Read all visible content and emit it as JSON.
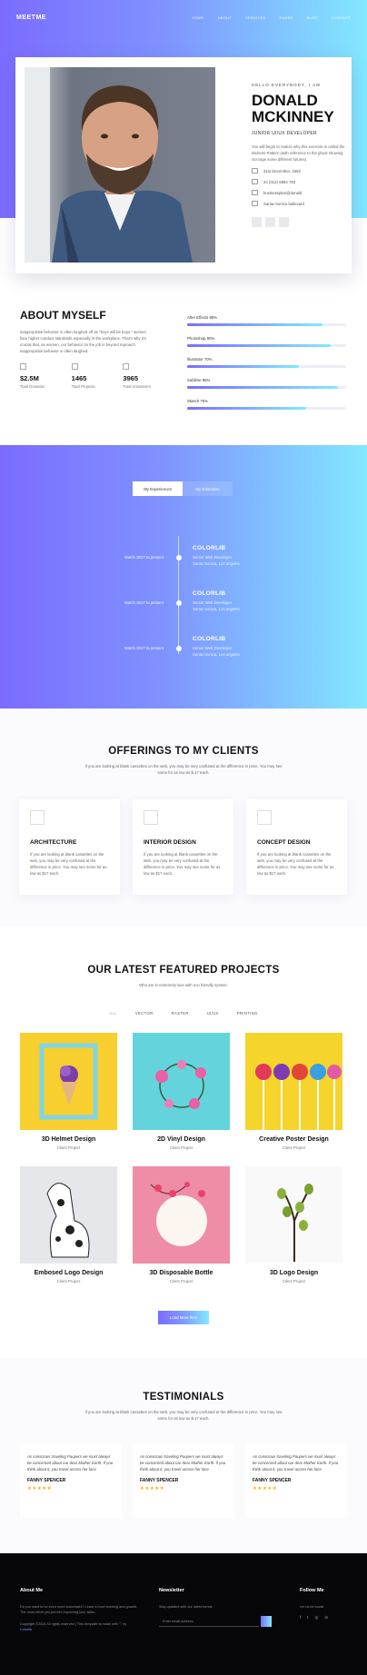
{
  "header": {
    "logo": "MEETME",
    "menu": [
      "HOME",
      "ABOUT",
      "SERVICES",
      "PAGES",
      "BLOG",
      "CONTACT"
    ]
  },
  "profile": {
    "greeting": "HELLO EVERYBODY, I AM",
    "name_line1": "DONALD",
    "name_line2": "MCKINNEY",
    "role": "JUNIOR UI/UX DEVELOPER",
    "bio": "You will begin to realize why this exercise is called the Dickens Pattern (with reference to the ghost showing Scrooge some different futures)",
    "contacts": [
      {
        "icon": "calendar-icon",
        "text": "31st December, 1992"
      },
      {
        "icon": "phone-icon",
        "text": "44 (012) 6954 783"
      },
      {
        "icon": "mail-icon",
        "text": "businessplan@donald"
      },
      {
        "icon": "home-icon",
        "text": "Santa monica bullevard"
      }
    ]
  },
  "about": {
    "title": "ABOUT MYSELF",
    "text": "inappropriate behavior is often laughed off as \"boys will be boys,\" women face higher conduct standards especially in the workplace. That's why it's crucial that, as women, our behavior on the job is beyond reproach. inappropriate behavior is often laughed.",
    "stats": [
      {
        "icon": "donation-icon",
        "value": "$2.5M",
        "label": "Total Donation"
      },
      {
        "icon": "projects-icon",
        "value": "1465",
        "label": "Total Projects"
      },
      {
        "icon": "volunteers-icon",
        "value": "3965",
        "label": "Total Volunteers"
      }
    ],
    "skills": [
      {
        "label": "After Effects 85%",
        "percent": 85
      },
      {
        "label": "Photoshop 90%",
        "percent": 90
      },
      {
        "label": "Illustrator 70%",
        "percent": 70
      },
      {
        "label": "Sublime 95%",
        "percent": 95
      },
      {
        "label": "Sketch 75%",
        "percent": 75
      }
    ]
  },
  "timeline": {
    "tabs": [
      "My Experiences",
      "My Education"
    ],
    "items": [
      {
        "date": "March 2017 to present",
        "title": "COLORLIB",
        "sub1": "Senior Web Developer",
        "sub2": "Santa monica, Los angeles"
      },
      {
        "date": "March 2017 to present",
        "title": "COLORLIB",
        "sub1": "Senior Web Developer",
        "sub2": "Santa monica, Los angeles"
      },
      {
        "date": "March 2017 to present",
        "title": "COLORLIB",
        "sub1": "Senior Web Developer",
        "sub2": "Santa monica, Los angeles"
      }
    ]
  },
  "offerings": {
    "title": "OFFERINGS TO MY CLIENTS",
    "subtitle": "If you are looking at blank cassettes on the web, you may be very confused at the difference in price. You may see some for as low as $.17 each.",
    "items": [
      {
        "icon": "architecture-icon",
        "title": "ARCHITECTURE",
        "text": "If you are looking at blank cassettes on the web, you may be very confused at the difference in price. You may see some for as low as $17 each."
      },
      {
        "icon": "interior-design-icon",
        "title": "INTERIOR DESIGN",
        "text": "If you are looking at blank cassettes on the web, you may be very confused at the difference in price. You may see some for as low as $17 each."
      },
      {
        "icon": "concept-design-icon",
        "title": "CONCEPT DESIGN",
        "text": "If you are looking at blank cassettes on the web, you may be very confused at the difference in price. You may see some for as low as $17 each."
      }
    ]
  },
  "projects": {
    "title": "OUR LATEST FEATURED PROJECTS",
    "subtitle": "Who are in extremely love with eco friendly system.",
    "filters": [
      "ALL",
      "VECTOR",
      "RASTER",
      "UI/UX",
      "PRINTING"
    ],
    "items": [
      {
        "title": "3D Helmet Design",
        "category": "Client Project",
        "bg": "#f7cf2f",
        "art": "icecream"
      },
      {
        "title": "2D Vinyl Design",
        "category": "Client Project",
        "bg": "#64d4dc",
        "art": "wreath"
      },
      {
        "title": "Creative Poster Design",
        "category": "Client Project",
        "bg": "#f5d42c",
        "art": "lollipops"
      },
      {
        "title": "Embosed Logo Design",
        "category": "Client Project",
        "bg": "#e6e7ea",
        "art": "dog"
      },
      {
        "title": "3D Disposable Bottle",
        "category": "Client Project",
        "bg": "#ee8da5",
        "art": "plate"
      },
      {
        "title": "3D Logo Design",
        "category": "Client Project",
        "bg": "#f9f9f9",
        "art": "branch"
      }
    ],
    "load_more": "Load More Item"
  },
  "testimonials": {
    "title": "TESTIMONIALS",
    "subtitle": "If you are looking at blank cassettes on the web, you may be very confused at the difference in price. You may see some for as low as $.17 each.",
    "items": [
      {
        "quote": "As conscious traveling Paupers we must always be concerned about our dear Mother Earth. If you think about it, you travel across her face",
        "name": "FANNY SPENCER",
        "stars": "★★★★★"
      },
      {
        "quote": "As conscious traveling Paupers we must always be concerned about our dear Mother Earth. If you think about it, you travel across her face",
        "name": "FANNY SPENCER",
        "stars": "★★★★★"
      },
      {
        "quote": "As conscious traveling Paupers we must always be concerned about our dear Mother Earth. If you think about it, you travel across her face",
        "name": "FANNY SPENCER",
        "stars": "★★★★★"
      }
    ]
  },
  "footer": {
    "about_title": "About Me",
    "about_text": "Do you want to be even more successful? Learn to love learning and growth. The more effort you put into improving your skills,",
    "copyright": "Copyright ©2024 All rights reserved | This template is made with ♡ by",
    "copyright_link": "Colorlib",
    "newsletter_title": "Newsletter",
    "newsletter_text": "Stay updated with our latest trends",
    "newsletter_placeholder": "Enter email address",
    "follow_title": "Follow Me",
    "follow_text": "Let us be social",
    "social": [
      "f",
      "t",
      "◎",
      "in"
    ]
  },
  "colors": {
    "gradient_start": "#7b6cff",
    "gradient_end": "#82e9ff",
    "star": "#f5b400",
    "footer_bg": "#07070a"
  }
}
